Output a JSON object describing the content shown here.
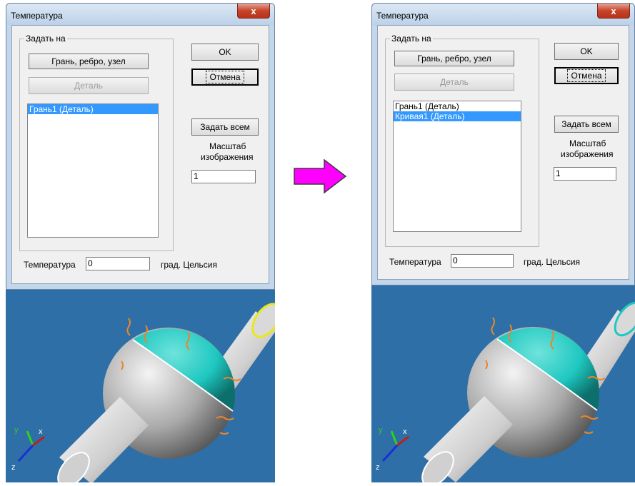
{
  "left": {
    "dialog": {
      "title": "Температура",
      "close_label": "x",
      "group_label": "Задать на",
      "mode_button": "Грань, ребро, узел",
      "part_button": "Деталь",
      "list_items": [
        {
          "label": "Грань1 (Деталь)",
          "selected": true
        }
      ],
      "ok_button": "OK",
      "cancel_button": "Отмена",
      "set_all_button": "Задать всем",
      "scale_label_line1": "Масштаб",
      "scale_label_line2": "изображения",
      "scale_value": "1",
      "temp_label": "Температура",
      "temp_value": "0",
      "temp_unit": "град. Цельсия"
    }
  },
  "right": {
    "dialog": {
      "title": "Температура",
      "close_label": "x",
      "group_label": "Задать на",
      "mode_button": "Грань, ребро, узел",
      "part_button": "Деталь",
      "list_items": [
        {
          "label": "Грань1 (Деталь)",
          "selected": false
        },
        {
          "label": "Кривая1 (Деталь)",
          "selected": true
        }
      ],
      "ok_button": "OK",
      "cancel_button": "Отмена",
      "set_all_button": "Задать всем",
      "scale_label_line1": "Масштаб",
      "scale_label_line2": "изображения",
      "scale_value": "1",
      "temp_label": "Температура",
      "temp_value": "0",
      "temp_unit": "град. Цельсия"
    }
  },
  "scene": {
    "axis_labels": {
      "x": "x",
      "y": "y",
      "z": "z"
    }
  },
  "colors": {
    "arrow": "#ff00ff",
    "viewport_bg": "#2d6fa6",
    "highlight_face": "#1ec8c0",
    "highlight_edge": "#e8e81a",
    "selection": "#3399ff"
  }
}
